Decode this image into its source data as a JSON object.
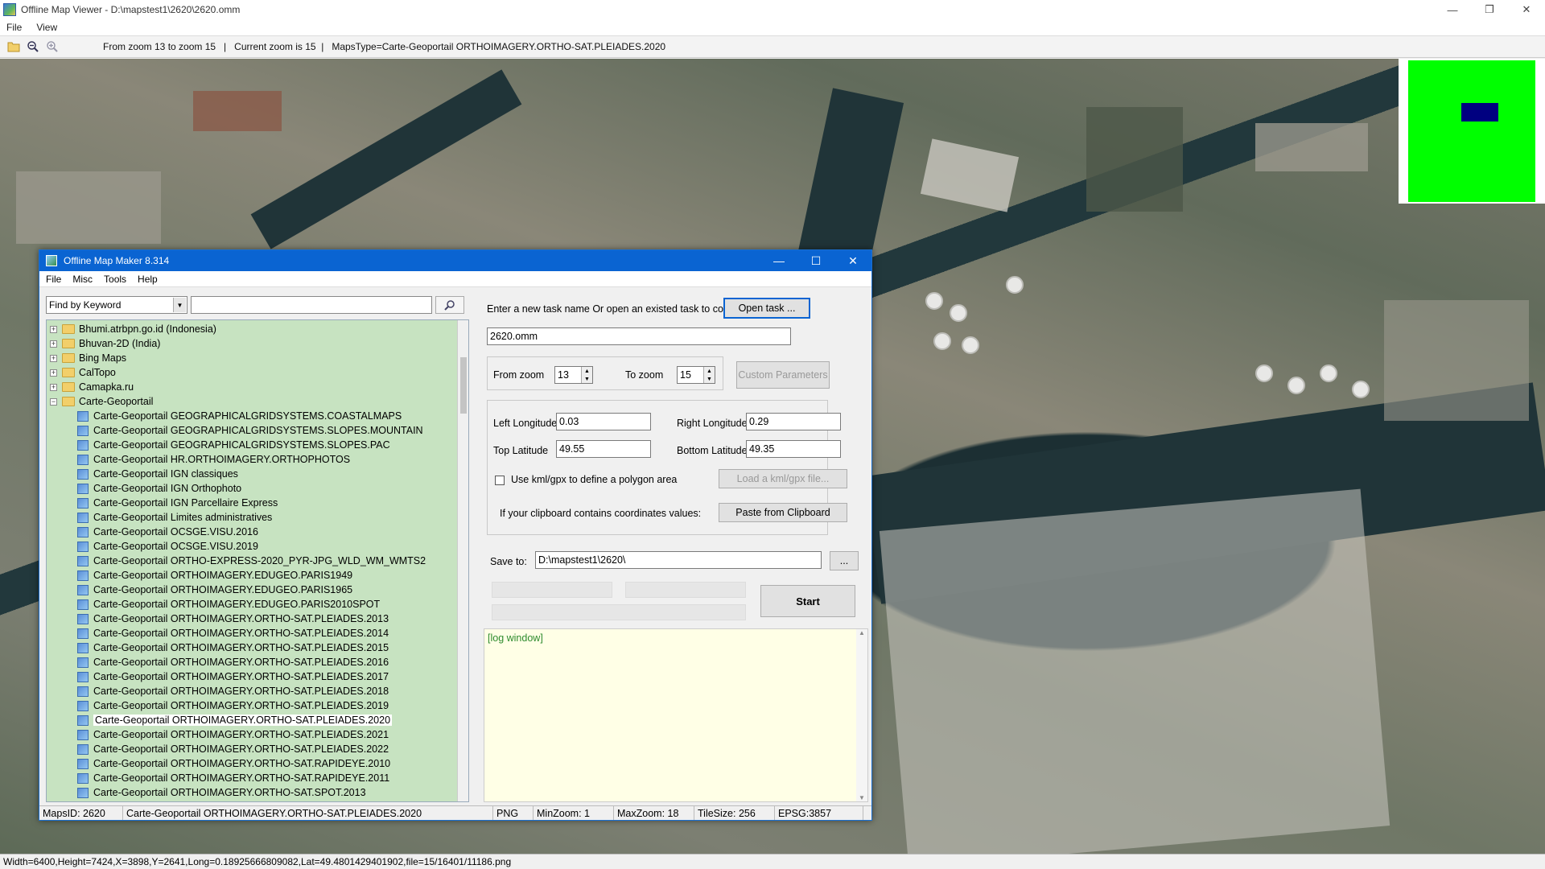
{
  "window": {
    "title": "Offline Map Viewer - D:\\mapstest1\\2620\\2620.omm",
    "controls": {
      "minimize": "—",
      "restore": "❐",
      "close": "✕"
    }
  },
  "menu": [
    "File",
    "View"
  ],
  "toolbar": {
    "info": "From zoom 13 to zoom 15   |   Current zoom is 15  |   MapsType=Carte-Geoportail ORTHOIMAGERY.ORTHO-SAT.PLEIADES.2020"
  },
  "statusbar": "Width=6400,Height=7424,X=3898,Y=2641,Long=0.18925666809082,Lat=49.4801429401902,file=15/16401/11186.png",
  "dialog": {
    "title": "Offline Map Maker 8.314",
    "controls": {
      "minimize": "—",
      "maximize": "☐",
      "close": "✕"
    },
    "menu": [
      "File",
      "Misc",
      "Tools",
      "Help"
    ],
    "search": {
      "mode": "Find by Keyword",
      "value": ""
    },
    "tree": [
      {
        "label": "Bhumi.atrbpn.go.id (Indonesia)",
        "level": 0,
        "type": "folder",
        "exp": "+"
      },
      {
        "label": "Bhuvan-2D (India)",
        "level": 0,
        "type": "folder",
        "exp": "+"
      },
      {
        "label": "Bing Maps",
        "level": 0,
        "type": "folder",
        "exp": "+"
      },
      {
        "label": "CalTopo",
        "level": 0,
        "type": "folder",
        "exp": "+"
      },
      {
        "label": "Camapka.ru",
        "level": 0,
        "type": "folder",
        "exp": "+"
      },
      {
        "label": "Carte-Geoportail",
        "level": 0,
        "type": "folder",
        "exp": "−"
      },
      {
        "label": "Carte-Geoportail GEOGRAPHICALGRIDSYSTEMS.COASTALMAPS",
        "level": 1,
        "type": "map"
      },
      {
        "label": "Carte-Geoportail GEOGRAPHICALGRIDSYSTEMS.SLOPES.MOUNTAIN",
        "level": 1,
        "type": "map"
      },
      {
        "label": "Carte-Geoportail GEOGRAPHICALGRIDSYSTEMS.SLOPES.PAC",
        "level": 1,
        "type": "map"
      },
      {
        "label": "Carte-Geoportail HR.ORTHOIMAGERY.ORTHOPHOTOS",
        "level": 1,
        "type": "map"
      },
      {
        "label": "Carte-Geoportail IGN classiques",
        "level": 1,
        "type": "map"
      },
      {
        "label": "Carte-Geoportail IGN Orthophoto",
        "level": 1,
        "type": "map"
      },
      {
        "label": "Carte-Geoportail IGN Parcellaire Express",
        "level": 1,
        "type": "map"
      },
      {
        "label": "Carte-Geoportail Limites administratives",
        "level": 1,
        "type": "map"
      },
      {
        "label": "Carte-Geoportail OCSGE.VISU.2016",
        "level": 1,
        "type": "map"
      },
      {
        "label": "Carte-Geoportail OCSGE.VISU.2019",
        "level": 1,
        "type": "map"
      },
      {
        "label": "Carte-Geoportail ORTHO-EXPRESS-2020_PYR-JPG_WLD_WM_WMTS2",
        "level": 1,
        "type": "map"
      },
      {
        "label": "Carte-Geoportail ORTHOIMAGERY.EDUGEO.PARIS1949",
        "level": 1,
        "type": "map"
      },
      {
        "label": "Carte-Geoportail ORTHOIMAGERY.EDUGEO.PARIS1965",
        "level": 1,
        "type": "map"
      },
      {
        "label": "Carte-Geoportail ORTHOIMAGERY.EDUGEO.PARIS2010SPOT",
        "level": 1,
        "type": "map"
      },
      {
        "label": "Carte-Geoportail ORTHOIMAGERY.ORTHO-SAT.PLEIADES.2013",
        "level": 1,
        "type": "map"
      },
      {
        "label": "Carte-Geoportail ORTHOIMAGERY.ORTHO-SAT.PLEIADES.2014",
        "level": 1,
        "type": "map"
      },
      {
        "label": "Carte-Geoportail ORTHOIMAGERY.ORTHO-SAT.PLEIADES.2015",
        "level": 1,
        "type": "map"
      },
      {
        "label": "Carte-Geoportail ORTHOIMAGERY.ORTHO-SAT.PLEIADES.2016",
        "level": 1,
        "type": "map"
      },
      {
        "label": "Carte-Geoportail ORTHOIMAGERY.ORTHO-SAT.PLEIADES.2017",
        "level": 1,
        "type": "map"
      },
      {
        "label": "Carte-Geoportail ORTHOIMAGERY.ORTHO-SAT.PLEIADES.2018",
        "level": 1,
        "type": "map"
      },
      {
        "label": "Carte-Geoportail ORTHOIMAGERY.ORTHO-SAT.PLEIADES.2019",
        "level": 1,
        "type": "map"
      },
      {
        "label": "Carte-Geoportail ORTHOIMAGERY.ORTHO-SAT.PLEIADES.2020",
        "level": 1,
        "type": "map",
        "selected": true
      },
      {
        "label": "Carte-Geoportail ORTHOIMAGERY.ORTHO-SAT.PLEIADES.2021",
        "level": 1,
        "type": "map"
      },
      {
        "label": "Carte-Geoportail ORTHOIMAGERY.ORTHO-SAT.PLEIADES.2022",
        "level": 1,
        "type": "map"
      },
      {
        "label": "Carte-Geoportail ORTHOIMAGERY.ORTHO-SAT.RAPIDEYE.2010",
        "level": 1,
        "type": "map"
      },
      {
        "label": "Carte-Geoportail ORTHOIMAGERY.ORTHO-SAT.RAPIDEYE.2011",
        "level": 1,
        "type": "map"
      },
      {
        "label": "Carte-Geoportail ORTHOIMAGERY.ORTHO-SAT.SPOT.2013",
        "level": 1,
        "type": "map"
      }
    ],
    "task": {
      "prompt": "Enter a new task name Or open an existed task to continue:",
      "open_button": "Open task ...",
      "name": "2620.omm"
    },
    "zoom": {
      "from_label": "From zoom",
      "from_value": "13",
      "to_label": "To zoom",
      "to_value": "15",
      "custom_button": "Custom Parameters"
    },
    "coords": {
      "left_label": "Left Longitude",
      "left_value": "0.03",
      "right_label": "Right Longitude",
      "right_value": "0.29",
      "top_label": "Top Latitude",
      "top_value": "49.55",
      "bottom_label": "Bottom Latitude",
      "bottom_value": "49.35",
      "kml_label": "Use kml/gpx to define a polygon area",
      "kml_button": "Load a kml/gpx file...",
      "clipboard_label": "If your clipboard contains coordinates values:",
      "clipboard_button": "Paste from Clipboard"
    },
    "save": {
      "label": "Save to:",
      "path": "D:\\mapstest1\\2620\\",
      "browse": "...",
      "start": "Start"
    },
    "log": "[log window]",
    "status": {
      "mapsid": "MapsID: 2620",
      "name": "Carte-Geoportail ORTHOIMAGERY.ORTHO-SAT.PLEIADES.2020",
      "format": "PNG",
      "minzoom": "MinZoom: 1",
      "maxzoom": "MaxZoom: 18",
      "tilesize": "TileSize: 256",
      "epsg": "EPSG:3857"
    }
  }
}
